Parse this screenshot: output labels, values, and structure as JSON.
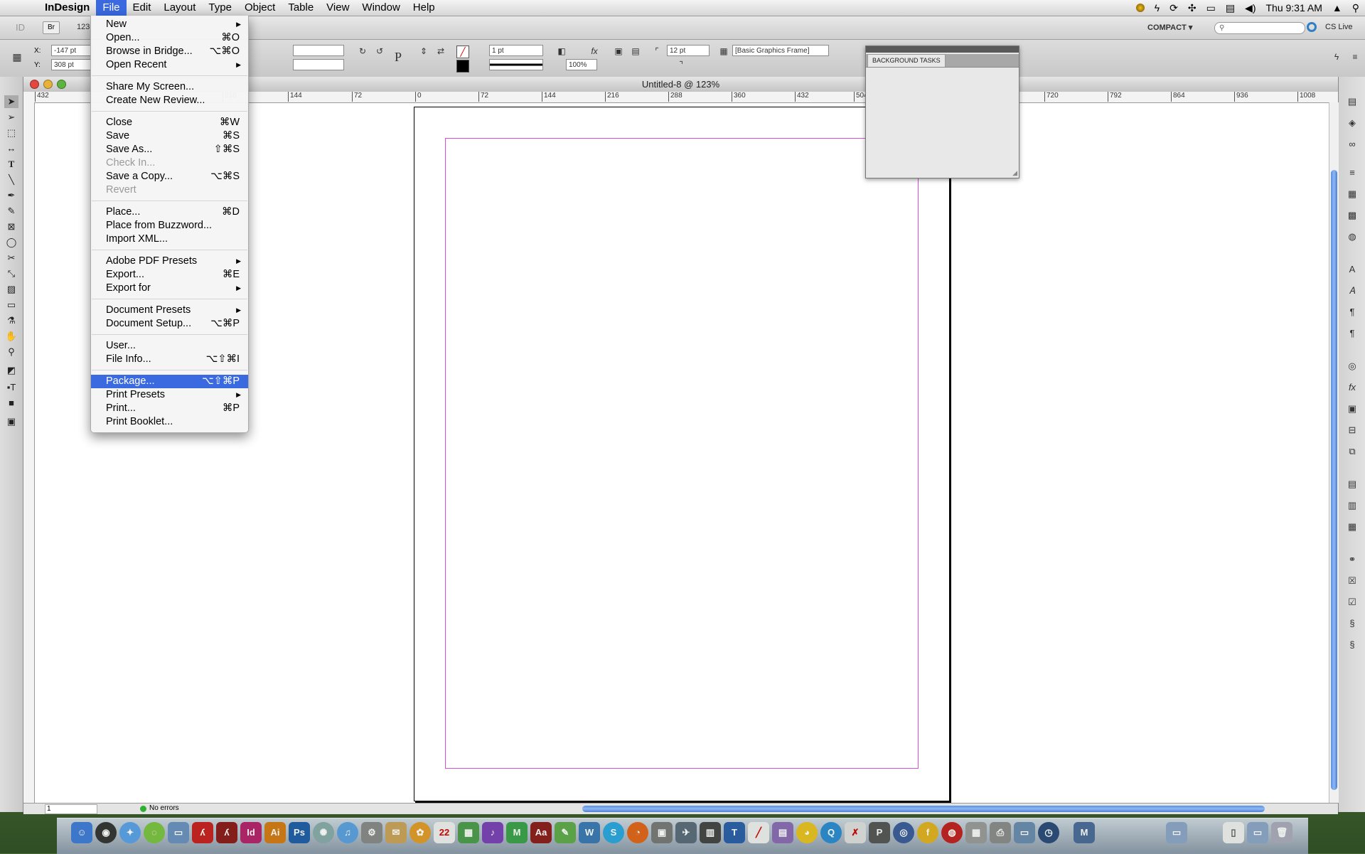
{
  "menubar": {
    "apple": "",
    "app_name": "InDesign",
    "items": [
      "File",
      "Edit",
      "Layout",
      "Type",
      "Object",
      "Table",
      "View",
      "Window",
      "Help"
    ],
    "clock": "Thu 9:31 AM"
  },
  "appbar": {
    "br": "Br",
    "zoom": "123",
    "workspace": "COMPACT ▾",
    "cs_live": "CS Live"
  },
  "control": {
    "x_label": "X:",
    "x_value": "-147 pt",
    "y_label": "Y:",
    "y_value": "308 pt",
    "stroke_weight": "1 pt",
    "opacity": "100%",
    "corner": "12 pt",
    "object_style": "[Basic Graphics Frame]"
  },
  "document": {
    "title": "Untitled-8 @ 123%",
    "ruler_labels": [
      "432",
      "216",
      "144",
      "72",
      "0",
      "72",
      "144",
      "216",
      "288",
      "360",
      "432",
      "504",
      "720",
      "792",
      "864",
      "936",
      "1008"
    ],
    "page_number": "1",
    "preflight": "No errors"
  },
  "bgtasks": {
    "tab_label": "BACKGROUND TASKS"
  },
  "filemenu": {
    "items": [
      {
        "label": "New",
        "shortcut": "",
        "submenu": true,
        "disabled": false
      },
      {
        "label": "Open...",
        "shortcut": "⌘O",
        "submenu": false,
        "disabled": false
      },
      {
        "label": "Browse in Bridge...",
        "shortcut": "⌥⌘O",
        "submenu": false,
        "disabled": false
      },
      {
        "label": "Open Recent",
        "shortcut": "",
        "submenu": true,
        "disabled": false
      },
      {
        "label": "Share My Screen...",
        "shortcut": "",
        "submenu": false,
        "disabled": false
      },
      {
        "label": "Create New Review...",
        "shortcut": "",
        "submenu": false,
        "disabled": false
      },
      {
        "label": "Close",
        "shortcut": "⌘W",
        "submenu": false,
        "disabled": false
      },
      {
        "label": "Save",
        "shortcut": "⌘S",
        "submenu": false,
        "disabled": false
      },
      {
        "label": "Save As...",
        "shortcut": "⇧⌘S",
        "submenu": false,
        "disabled": false
      },
      {
        "label": "Check In...",
        "shortcut": "",
        "submenu": false,
        "disabled": true
      },
      {
        "label": "Save a Copy...",
        "shortcut": "⌥⌘S",
        "submenu": false,
        "disabled": false
      },
      {
        "label": "Revert",
        "shortcut": "",
        "submenu": false,
        "disabled": true
      },
      {
        "label": "Place...",
        "shortcut": "⌘D",
        "submenu": false,
        "disabled": false
      },
      {
        "label": "Place from Buzzword...",
        "shortcut": "",
        "submenu": false,
        "disabled": false
      },
      {
        "label": "Import XML...",
        "shortcut": "",
        "submenu": false,
        "disabled": false
      },
      {
        "label": "Adobe PDF Presets",
        "shortcut": "",
        "submenu": true,
        "disabled": false
      },
      {
        "label": "Export...",
        "shortcut": "⌘E",
        "submenu": false,
        "disabled": false
      },
      {
        "label": "Export for",
        "shortcut": "",
        "submenu": true,
        "disabled": false
      },
      {
        "label": "Document Presets",
        "shortcut": "",
        "submenu": true,
        "disabled": false
      },
      {
        "label": "Document Setup...",
        "shortcut": "⌥⌘P",
        "submenu": false,
        "disabled": false
      },
      {
        "label": "User...",
        "shortcut": "",
        "submenu": false,
        "disabled": false
      },
      {
        "label": "File Info...",
        "shortcut": "⌥⇧⌘I",
        "submenu": false,
        "disabled": false
      },
      {
        "label": "Package...",
        "shortcut": "⌥⇧⌘P",
        "submenu": false,
        "disabled": false,
        "highlighted": true
      },
      {
        "label": "Print Presets",
        "shortcut": "",
        "submenu": true,
        "disabled": false
      },
      {
        "label": "Print...",
        "shortcut": "⌘P",
        "submenu": false,
        "disabled": false
      },
      {
        "label": "Print Booklet...",
        "shortcut": "",
        "submenu": false,
        "disabled": false
      }
    ]
  },
  "dock": {
    "labels": [
      "Id",
      "Ai",
      "Ps",
      "22"
    ]
  },
  "colors": {
    "menu_highlight": "#3a69e0",
    "margin_guide": "#d64fd6",
    "scroll_thumb": "#5d8fe0"
  }
}
